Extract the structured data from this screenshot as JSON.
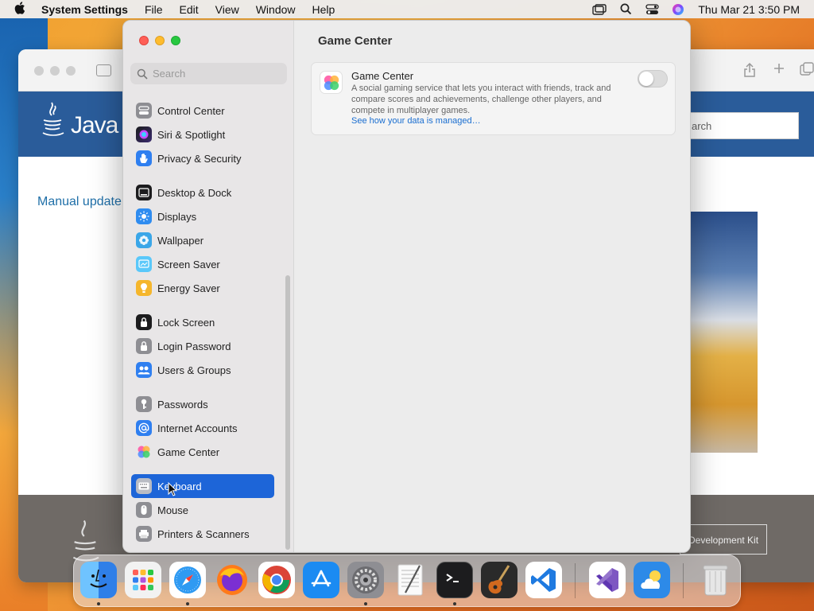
{
  "menubar": {
    "app_name": "System Settings",
    "menus": [
      "File",
      "Edit",
      "View",
      "Window",
      "Help"
    ],
    "clock": "Thu Mar 21  3:50 PM"
  },
  "background_window": {
    "search_placeholder": "arch",
    "manual_update": "Manual update",
    "logo_text": "Java",
    "dev_kit_button": "Development Kit"
  },
  "settings": {
    "search_placeholder": "Search",
    "sidebar": [
      {
        "label": "Control Center",
        "icon": "control-center-icon",
        "color": "#8e8e93"
      },
      {
        "label": "Siri & Spotlight",
        "icon": "siri-icon",
        "color": "#5b3ec8"
      },
      {
        "label": "Privacy & Security",
        "icon": "privacy-hand-icon",
        "color": "#2f7ff0"
      },
      {
        "label": "Desktop & Dock",
        "icon": "desktop-dock-icon",
        "color": "#1c1c1e"
      },
      {
        "label": "Displays",
        "icon": "displays-icon",
        "color": "#2f8cf0"
      },
      {
        "label": "Wallpaper",
        "icon": "wallpaper-icon",
        "color": "#3aa6e8"
      },
      {
        "label": "Screen Saver",
        "icon": "screen-saver-icon",
        "color": "#5ac8fa"
      },
      {
        "label": "Energy Saver",
        "icon": "energy-saver-icon",
        "color": "#f5b62c"
      },
      {
        "label": "Lock Screen",
        "icon": "lock-screen-icon",
        "color": "#1c1c1e"
      },
      {
        "label": "Login Password",
        "icon": "login-password-icon",
        "color": "#8e8e93"
      },
      {
        "label": "Users & Groups",
        "icon": "users-groups-icon",
        "color": "#2f7ff0"
      },
      {
        "label": "Passwords",
        "icon": "passwords-key-icon",
        "color": "#8e8e93"
      },
      {
        "label": "Internet Accounts",
        "icon": "internet-accounts-icon",
        "color": "#2f7ff0"
      },
      {
        "label": "Game Center",
        "icon": "game-center-icon",
        "color": "#ffffff"
      },
      {
        "label": "Keyboard",
        "icon": "keyboard-icon",
        "color": "#8e8e93"
      },
      {
        "label": "Mouse",
        "icon": "mouse-icon",
        "color": "#8e8e93"
      },
      {
        "label": "Printers & Scanners",
        "icon": "printer-icon",
        "color": "#8e8e93"
      }
    ],
    "selected_item": "Keyboard",
    "content": {
      "title": "Game Center",
      "card_title": "Game Center",
      "card_description": "A social gaming service that lets you interact with friends, track and compare scores and achievements, challenge other players, and compete in multiplayer games.",
      "card_link": "See how your data is managed…",
      "toggle_on": false
    }
  },
  "dock": [
    {
      "name": "finder-icon",
      "color": "#3a8ef0",
      "running": true
    },
    {
      "name": "launchpad-icon",
      "color": "#f2f2f2",
      "running": false
    },
    {
      "name": "safari-icon",
      "color": "#2f9af2",
      "running": true
    },
    {
      "name": "firefox-icon",
      "color": "#7b2fd2",
      "running": false
    },
    {
      "name": "chrome-icon",
      "color": "#ffffff",
      "running": false
    },
    {
      "name": "app-store-icon",
      "color": "#1b8bf2",
      "running": false
    },
    {
      "name": "system-settings-icon",
      "color": "#8e8e93",
      "running": true
    },
    {
      "name": "textedit-icon",
      "color": "#f5f5f5",
      "running": false
    },
    {
      "name": "terminal-icon",
      "color": "#1c1c1e",
      "running": true
    },
    {
      "name": "garageband-icon",
      "color": "#2a2a2a",
      "running": false
    },
    {
      "name": "vscode-icon",
      "color": "#ffffff",
      "running": false
    },
    {
      "name": "visual-studio-icon",
      "color": "#ffffff",
      "running": false
    },
    {
      "name": "weather-icon",
      "color": "#2d8ae8",
      "running": false
    },
    {
      "name": "trash-icon",
      "color": "#e8e8e8",
      "running": false
    }
  ]
}
